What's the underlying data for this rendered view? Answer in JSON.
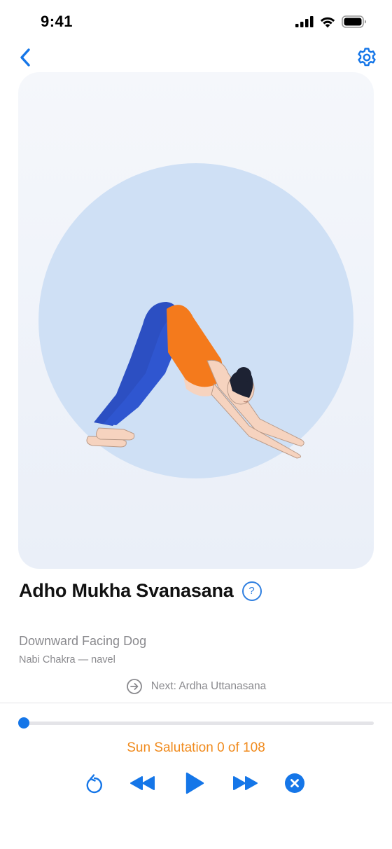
{
  "status_bar": {
    "time": "9:41",
    "icons": [
      "cellular-signal-icon",
      "wifi-icon",
      "battery-icon"
    ]
  },
  "nav": {
    "back_icon": "chevron-left-icon",
    "settings_icon": "gear-icon"
  },
  "pose": {
    "sanskrit_name": "Adho Mukha Svanasana",
    "english_name": "Downward Facing Dog",
    "chakra": "Nabi Chakra — navel",
    "help_icon": "question-mark-icon",
    "help_glyph": "?"
  },
  "next": {
    "icon": "arrow-right-circle-icon",
    "label": "Next: Ardha Uttanasana"
  },
  "progress": {
    "completed": 0,
    "total": 108,
    "fraction": 0.0
  },
  "session": {
    "label": "Sun Salutation 0 of 108"
  },
  "controls": {
    "items": [
      "restart-icon",
      "rewind-icon",
      "play-icon",
      "fast-forward-icon",
      "close-circle-icon"
    ]
  },
  "colors": {
    "accent": "#1576e8",
    "session_text": "#f08a1c",
    "card_bg": "#eef2f9",
    "circle_bg": "#cfe0f5",
    "leggings": "#2c4fc2",
    "top": "#f47a1c",
    "skin": "#f6d3bf",
    "hair": "#1d2233"
  }
}
